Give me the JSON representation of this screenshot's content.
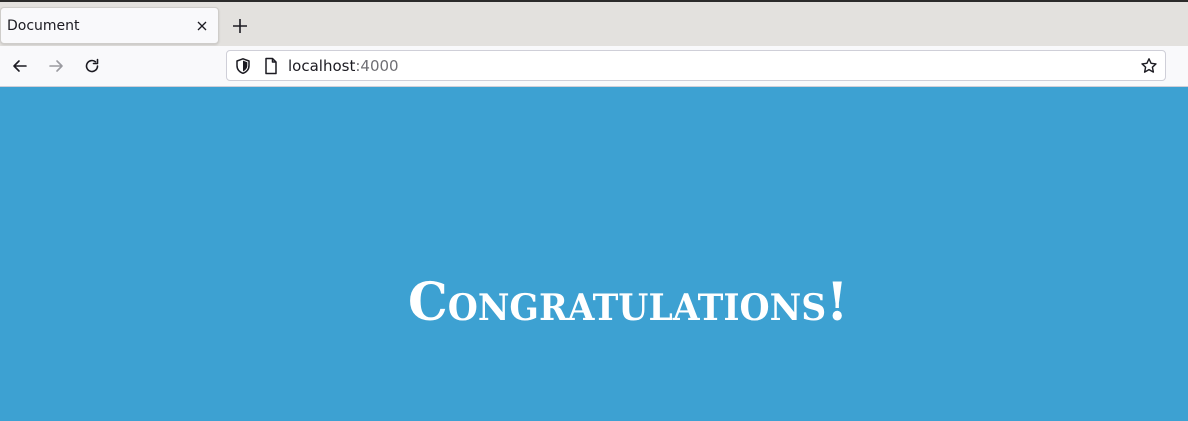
{
  "browser": {
    "tab": {
      "title": "Document"
    },
    "urlbar": {
      "host": "localhost",
      "port": ":4000"
    }
  },
  "page": {
    "headline": "Congratulations!",
    "background_color": "#3da1d2"
  },
  "icons": {
    "tab_close": "close-icon",
    "new_tab": "plus-icon",
    "back": "arrow-left-icon",
    "forward": "arrow-right-icon",
    "reload": "reload-icon",
    "shield": "shield-icon",
    "page": "page-icon",
    "bookmark": "star-icon"
  }
}
